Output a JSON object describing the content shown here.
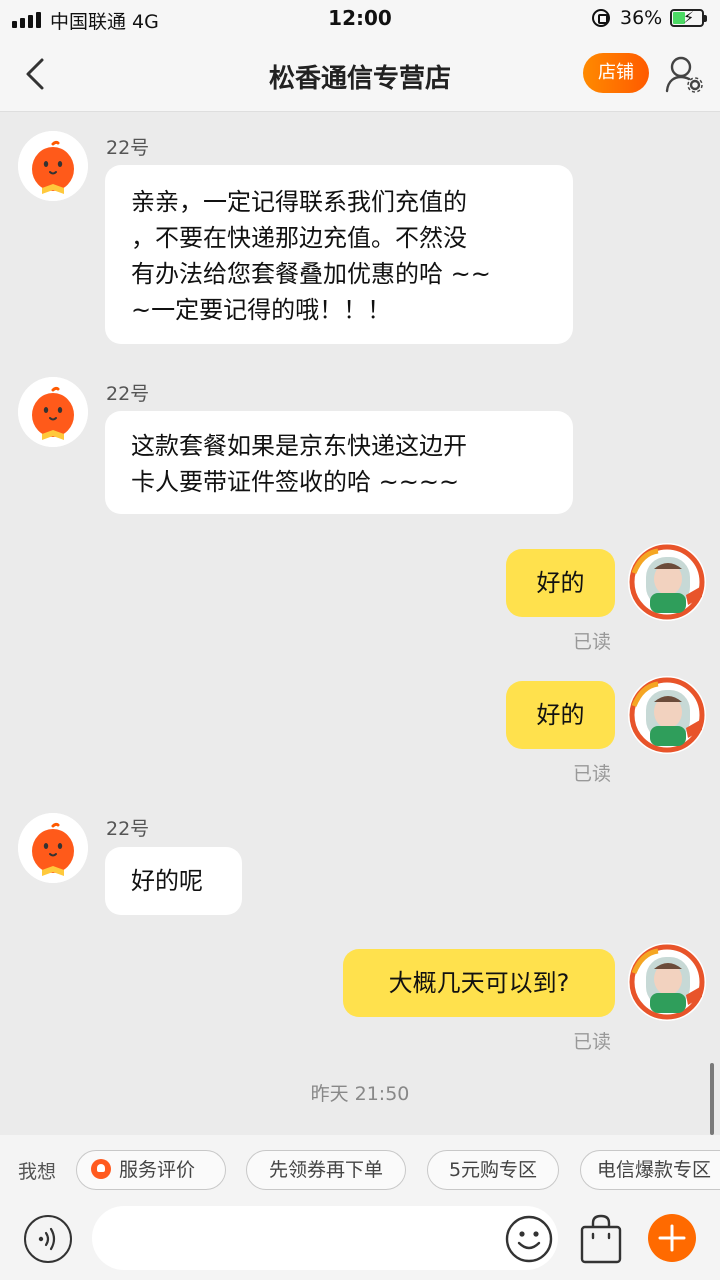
{
  "status_bar": {
    "carrier": "中国联通  4G",
    "time": "12:00",
    "battery": "36%"
  },
  "nav": {
    "title": "松香通信专营店",
    "shop_button": "店铺"
  },
  "messages": [
    {
      "sender": "22号",
      "text_lines": [
        "亲亲，一定记得联系我们充值的",
        "，不要在快递那边充值。不然没",
        "有办法给您套餐叠加优惠的哈 ~~",
        "~一定要记得的哦！！！"
      ]
    },
    {
      "sender": "22号",
      "text_lines": [
        "这款套餐如果是京东快递这边开",
        "卡人要带证件签收的哈 ~~~~"
      ]
    },
    {
      "text": "好的",
      "status": "已读"
    },
    {
      "text": "好的",
      "status": "已读"
    },
    {
      "sender": "22号",
      "text_lines": [
        "好的呢"
      ]
    },
    {
      "text": "大概几天可以到?",
      "status": "已读"
    }
  ],
  "timestamp": "昨天 21:50",
  "quick_bar": {
    "label": "我想",
    "chips": [
      "服务评价",
      "先领券再下单",
      "5元购专区",
      "电信爆款专区"
    ]
  },
  "colors": {
    "accent_orange": "#ff6a00",
    "outgoing_bubble": "#ffe14d",
    "incoming_bubble": "#ffffff",
    "background": "#ebebeb"
  }
}
